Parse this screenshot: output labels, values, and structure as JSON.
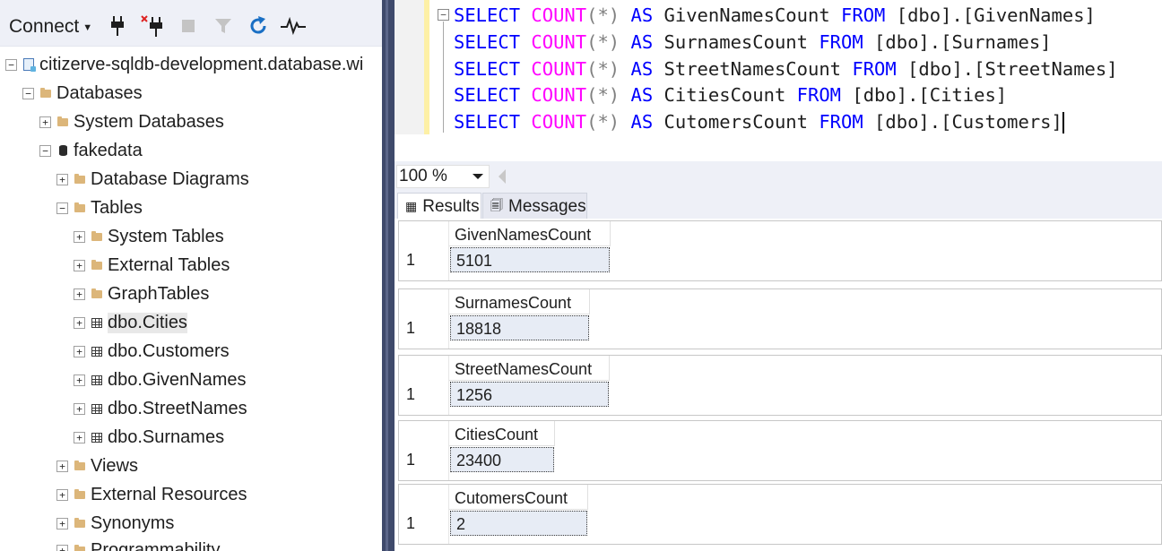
{
  "object_explorer": {
    "toolbar": {
      "connect_label": "Connect",
      "icons": [
        "connect-plug-icon",
        "disconnect-plug-icon",
        "stop-icon",
        "filter-icon",
        "refresh-icon",
        "activity-monitor-icon"
      ]
    },
    "tree": {
      "server": "citizerve-sqldb-development.database.wi",
      "databases": "Databases",
      "system_databases": "System Databases",
      "fakedata": "fakedata",
      "database_diagrams": "Database Diagrams",
      "tables": "Tables",
      "system_tables": "System Tables",
      "external_tables": "External Tables",
      "graph_tables": "GraphTables",
      "dbo_cities": "dbo.Cities",
      "dbo_customers": "dbo.Customers",
      "dbo_givennames": "dbo.GivenNames",
      "dbo_streetnames": "dbo.StreetNames",
      "dbo_surnames": "dbo.Surnames",
      "views": "Views",
      "external_resources": "External Resources",
      "synonyms": "Synonyms",
      "programmability": "Programmability"
    }
  },
  "editor": {
    "select": "SELECT",
    "count": "COUNT",
    "star": "(*)",
    "as": "AS",
    "from": "FROM",
    "lines": [
      {
        "alias": "GivenNamesCount",
        "table": "[dbo].[GivenNames]"
      },
      {
        "alias": "SurnamesCount",
        "table": "[dbo].[Surnames]"
      },
      {
        "alias": "StreetNamesCount",
        "table": "[dbo].[StreetNames]"
      },
      {
        "alias": "CitiesCount",
        "table": "[dbo].[Cities]"
      },
      {
        "alias": "CutomersCount",
        "table": "[dbo].[Customers]"
      }
    ]
  },
  "zoom": {
    "level": "100 %"
  },
  "tabs": {
    "results": "Results",
    "messages": "Messages"
  },
  "results": [
    {
      "column": "GivenNamesCount",
      "row": "1",
      "value": "5101"
    },
    {
      "column": "SurnamesCount",
      "row": "1",
      "value": "18818"
    },
    {
      "column": "StreetNamesCount",
      "row": "1",
      "value": "1256"
    },
    {
      "column": "CitiesCount",
      "row": "1",
      "value": "23400"
    },
    {
      "column": "CutomersCount",
      "row": "1",
      "value": "2"
    }
  ],
  "colors": {
    "keyword": "#0000ff",
    "function": "#ff00ff",
    "operator": "#808080",
    "splitter": "#3f4a6b",
    "toolbar_bg": "#eef0f7"
  }
}
